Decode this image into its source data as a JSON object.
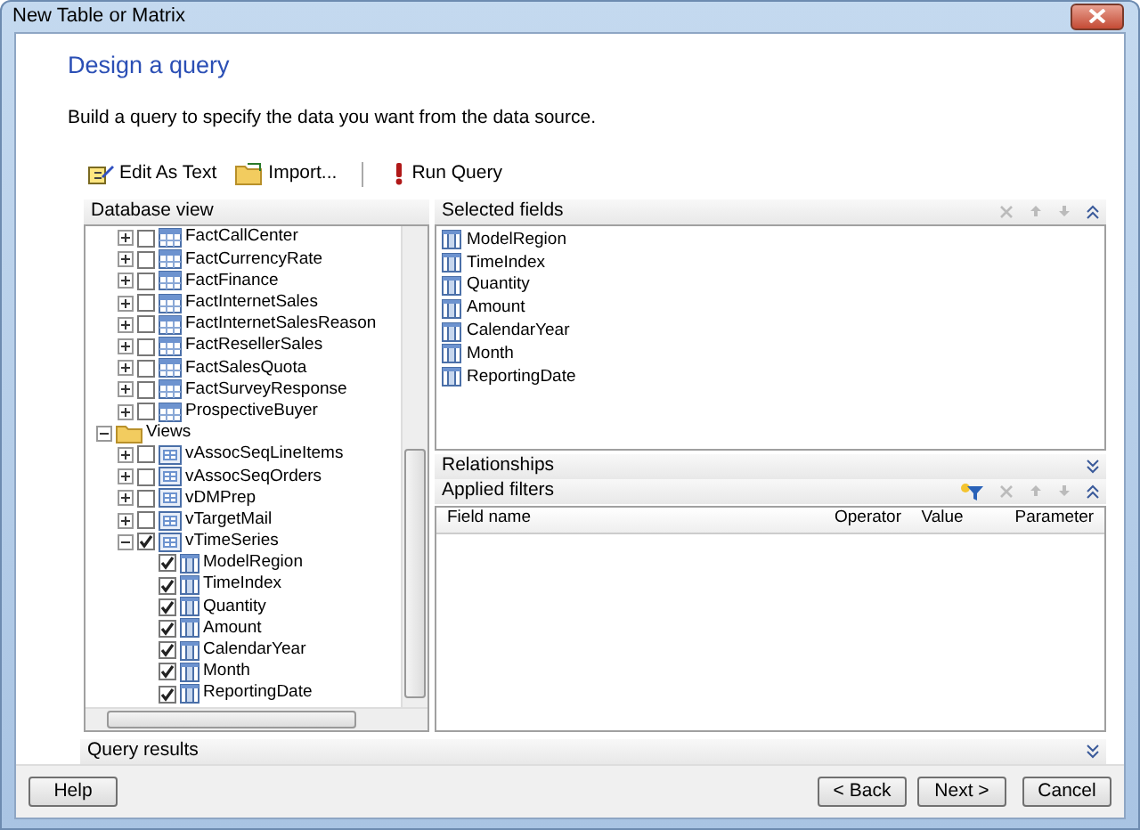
{
  "window": {
    "title": "New Table or Matrix"
  },
  "page": {
    "title": "Design a query",
    "description": "Build a query to specify the data you want from the data source."
  },
  "toolbar": [
    {
      "kind": "edit",
      "label": "Edit As Text"
    },
    {
      "kind": "import",
      "label": "Import..."
    },
    {
      "kind": "separator"
    },
    {
      "kind": "run",
      "label": "Run Query"
    }
  ],
  "database_view": {
    "title": "Database view",
    "tree": [
      {
        "kind": "continued",
        "children": [
          {
            "kind": "table",
            "label": "FactCallCenter",
            "checked": false,
            "expanded": false
          },
          {
            "kind": "table",
            "label": "FactCurrencyRate",
            "checked": false,
            "expanded": false
          },
          {
            "kind": "table",
            "label": "FactFinance",
            "checked": false,
            "expanded": false
          },
          {
            "kind": "table",
            "label": "FactInternetSales",
            "checked": false,
            "expanded": false
          },
          {
            "kind": "table",
            "label": "FactInternetSalesReason",
            "checked": false,
            "expanded": false
          },
          {
            "kind": "table",
            "label": "FactResellerSales",
            "checked": false,
            "expanded": false
          },
          {
            "kind": "table",
            "label": "FactSalesQuota",
            "checked": false,
            "expanded": false
          },
          {
            "kind": "table",
            "label": "FactSurveyResponse",
            "checked": false,
            "expanded": false
          },
          {
            "kind": "table",
            "label": "ProspectiveBuyer",
            "checked": false,
            "expanded": false
          }
        ]
      },
      {
        "kind": "folder",
        "label": "Views",
        "expanded": true,
        "children": [
          {
            "kind": "view",
            "label": "vAssocSeqLineItems",
            "checked": false,
            "expanded": false
          },
          {
            "kind": "view",
            "label": "vAssocSeqOrders",
            "checked": false,
            "expanded": false
          },
          {
            "kind": "view",
            "label": "vDMPrep",
            "checked": false,
            "expanded": false
          },
          {
            "kind": "view",
            "label": "vTargetMail",
            "checked": false,
            "expanded": false
          },
          {
            "kind": "view",
            "label": "vTimeSeries",
            "checked": true,
            "expanded": true,
            "children": [
              {
                "kind": "column",
                "label": "ModelRegion",
                "checked": true
              },
              {
                "kind": "column",
                "label": "TimeIndex",
                "checked": true
              },
              {
                "kind": "column",
                "label": "Quantity",
                "checked": true
              },
              {
                "kind": "column",
                "label": "Amount",
                "checked": true
              },
              {
                "kind": "column",
                "label": "CalendarYear",
                "checked": true
              },
              {
                "kind": "column",
                "label": "Month",
                "checked": true
              },
              {
                "kind": "column",
                "label": "ReportingDate",
                "checked": true
              }
            ]
          }
        ]
      }
    ]
  },
  "selected_fields": {
    "title": "Selected fields",
    "expanded": true,
    "fields": [
      "ModelRegion",
      "TimeIndex",
      "Quantity",
      "Amount",
      "CalendarYear",
      "Month",
      "ReportingDate"
    ]
  },
  "relationships": {
    "title": "Relationships",
    "expanded": false
  },
  "applied_filters": {
    "title": "Applied filters",
    "expanded": true,
    "columns": [
      "Field name",
      "Operator",
      "Value",
      "Parameter"
    ]
  },
  "query_results": {
    "title": "Query results",
    "expanded": false
  },
  "buttons": [
    {
      "label": "Help"
    },
    {
      "label": "< Back"
    },
    {
      "label": "Next >"
    },
    {
      "label": "Cancel"
    }
  ]
}
